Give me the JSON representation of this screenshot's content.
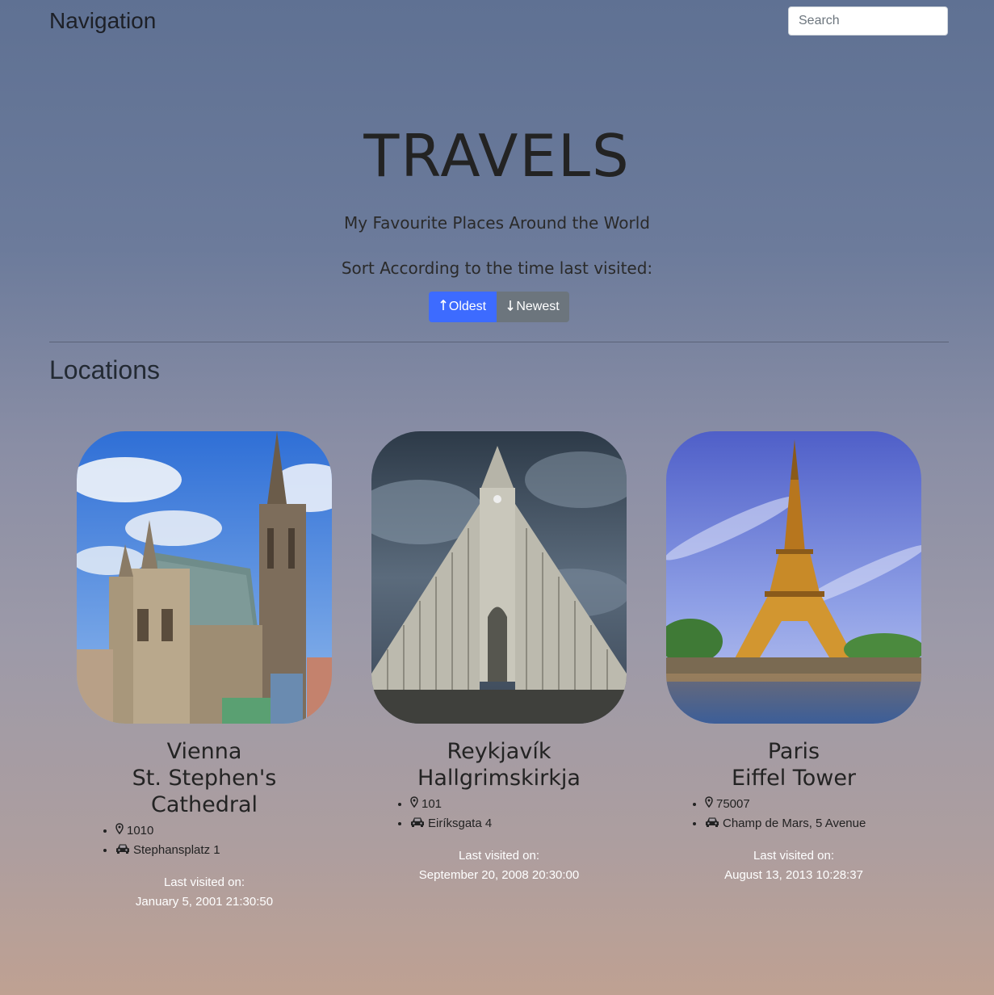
{
  "nav": {
    "brand": "Navigation",
    "search_placeholder": "Search"
  },
  "hero": {
    "title": "TRAVELS",
    "subtitle": "My Favourite Places Around the World",
    "sort_label": "Sort According to the time last visited:",
    "sort_buttons": {
      "oldest": "Oldest",
      "newest": "Newest",
      "oldest_icon": "arrow-up-icon",
      "newest_icon": "arrow-down-icon"
    }
  },
  "section": {
    "title": "Locations"
  },
  "locations": [
    {
      "city": "Vienna",
      "landmark": "St. Stephen's Cathedral",
      "postal_code": "1010",
      "address": "Stephansplatz 1",
      "visited_label": "Last visited on:",
      "visited_on": "January 5, 2001 21:30:50",
      "image": "st-stephens-cathedral-photo"
    },
    {
      "city": "Reykjavík",
      "landmark": "Hallgrimskirkja",
      "postal_code": "101",
      "address": "Eiríksgata 4",
      "visited_label": "Last visited on:",
      "visited_on": "September 20, 2008 20:30:00",
      "image": "hallgrimskirkja-photo"
    },
    {
      "city": "Paris",
      "landmark": "Eiffel Tower",
      "postal_code": "75007",
      "address": "Champ de Mars, 5 Avenue",
      "visited_label": "Last visited on:",
      "visited_on": "August 13, 2013 10:28:37",
      "image": "eiffel-tower-photo"
    }
  ],
  "colors": {
    "primary_button": "#3d6bff",
    "secondary_button": "#6c757d",
    "visited_text": "#ffffff"
  }
}
